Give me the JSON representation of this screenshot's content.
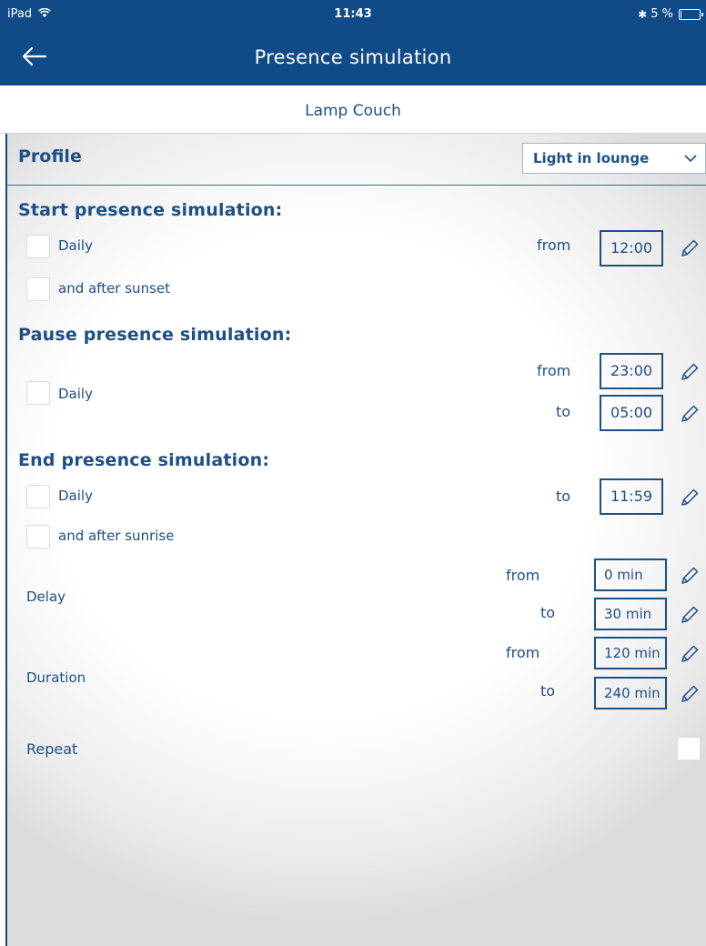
{
  "status_bar": {
    "carrier": "iPad",
    "time": "11:43",
    "battery_text": "5 %",
    "battery_level": 0.05,
    "icons": [
      "wifi-icon",
      "bluetooth-icon",
      "battery-icon"
    ]
  },
  "nav": {
    "title": "Presence simulation",
    "back_icon": "back-arrow-icon"
  },
  "device_name": "Lamp Couch",
  "profile": {
    "label": "Profile",
    "selected": "Light in lounge"
  },
  "start": {
    "title": "Start presence simulation:",
    "daily_label": "Daily",
    "sunset_label": "and after sunset",
    "from_label": "from",
    "from_value": "12:00"
  },
  "pause": {
    "title": "Pause presence simulation:",
    "daily_label": "Daily",
    "from_label": "from",
    "from_value": "23:00",
    "to_label": "to",
    "to_value": "05:00"
  },
  "end": {
    "title": "End presence simulation:",
    "daily_label": "Daily",
    "sunrise_label": "and after sunrise",
    "to_label": "to",
    "to_value": "11:59"
  },
  "delay": {
    "label": "Delay",
    "from_label": "from",
    "from_value": "0 min",
    "to_label": "to",
    "to_value": "30 min"
  },
  "duration": {
    "label": "Duration",
    "from_label": "from",
    "from_value": "120 min",
    "to_label": "to",
    "to_value": "240 min"
  },
  "repeat": {
    "label": "Repeat"
  },
  "colors": {
    "header": "#114b87",
    "text": "#1d4f86"
  }
}
